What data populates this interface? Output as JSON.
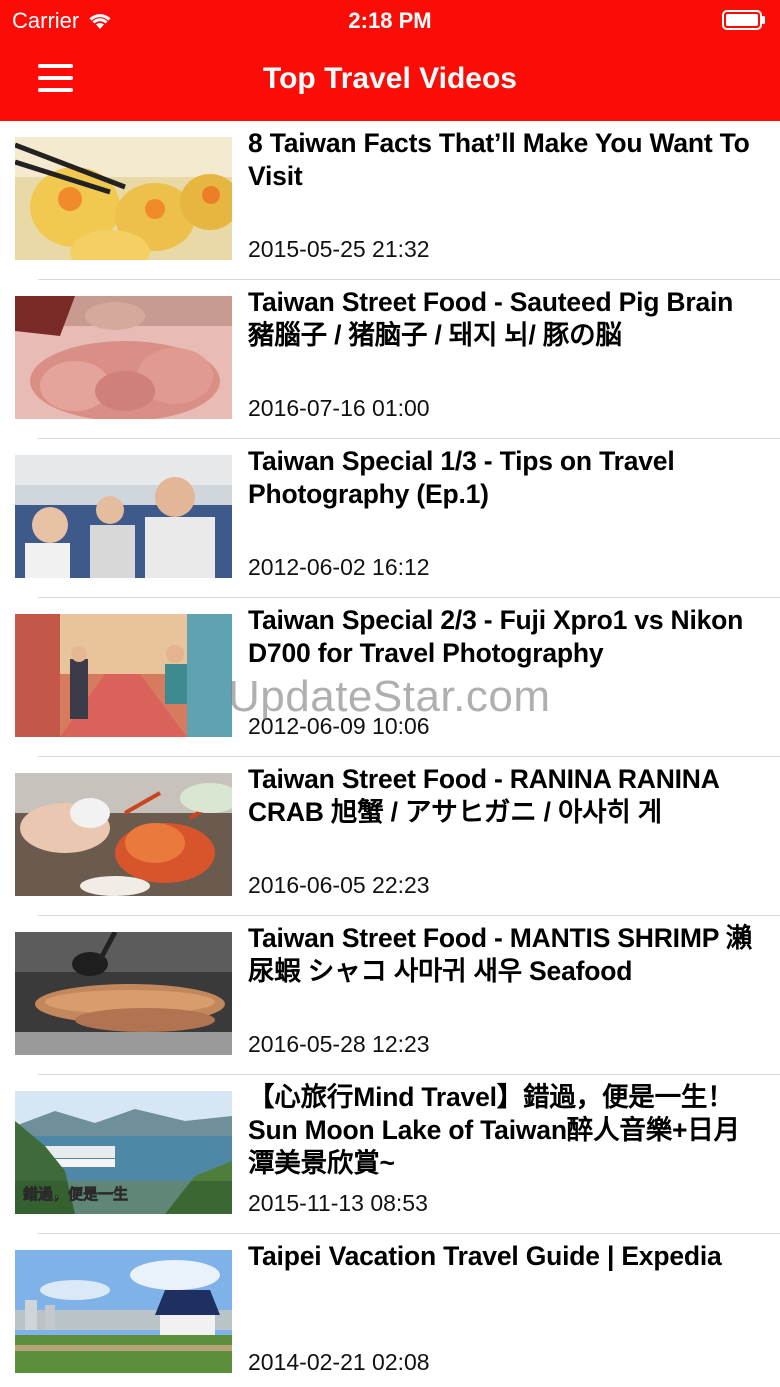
{
  "status_bar": {
    "carrier": "Carrier",
    "time": "2:18 PM"
  },
  "nav": {
    "title": "Top Travel Videos",
    "menu_icon": "hamburger-menu-icon"
  },
  "colors": {
    "accent": "#fb0c07"
  },
  "videos": [
    {
      "title": "8 Taiwan Facts That’ll Make You Want To Visit",
      "date": "2015-05-25 21:32"
    },
    {
      "title": "Taiwan Street Food - Sauteed Pig Brain  豬腦子 / 猪脑子 / 돼지 뇌/ 豚の脳",
      "date": "2016-07-16 01:00"
    },
    {
      "title": "Taiwan Special 1/3 - Tips on Travel Photography (Ep.1)",
      "date": "2012-06-02 16:12"
    },
    {
      "title": "Taiwan Special 2/3 - Fuji Xpro1 vs Nikon D700 for Travel Photography",
      "date": "2012-06-09 10:06"
    },
    {
      "title": "Taiwan Street Food - RANINA RANINA CRAB 旭蟹 / アサヒガニ / 아사히 게",
      "date": "2016-06-05 22:23"
    },
    {
      "title": "Taiwan Street Food - MANTIS SHRIMP 瀨尿蝦 シャコ 사마귀 새우 Seafood",
      "date": "2016-05-28 12:23"
    },
    {
      "title": "【心旅行Mind Travel】錯過，便是一生！Sun Moon Lake of Taiwan醉人音樂+日月潭美景欣賞~",
      "date": "2015-11-13 08:53"
    },
    {
      "title": "Taipei Vacation Travel Guide | Expedia",
      "date": "2014-02-21 02:08"
    }
  ],
  "thumbnail_text": {
    "row7_caption": "錯過，便是一生"
  },
  "watermark": "UpdateStar.com"
}
